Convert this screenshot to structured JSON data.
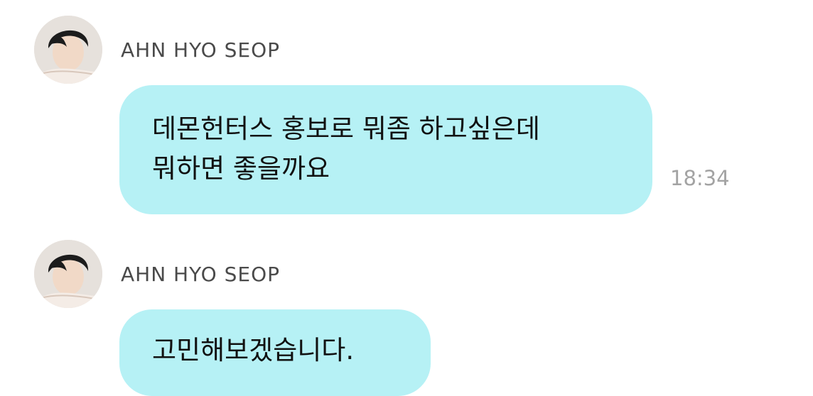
{
  "chat": {
    "messages": [
      {
        "sender": "AHN HYO SEOP",
        "lines": [
          "데몬헌터스 홍보로 뭐좀 하고싶은데",
          "뭐하면 좋을까요"
        ],
        "time": "18:34"
      },
      {
        "sender": "AHN HYO SEOP",
        "lines": [
          "고민해보겠습니다."
        ]
      }
    ]
  },
  "colors": {
    "bubble": "#b6f1f5",
    "sender_text": "#4a4a4a",
    "timestamp": "#a3a3a3",
    "background": "#ffffff"
  },
  "icons": {
    "avatar": "profile-photo"
  }
}
